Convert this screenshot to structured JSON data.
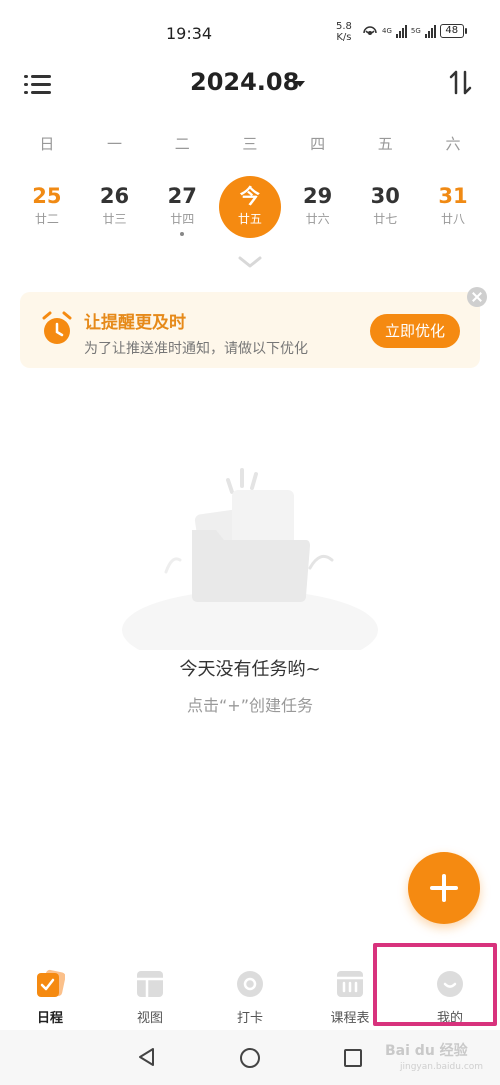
{
  "status_bar": {
    "time": "19:34",
    "speed_value": "5.8",
    "speed_unit": "K/s",
    "net_a": "4G",
    "net_b": "5G",
    "battery": "48"
  },
  "header": {
    "month": "2024.08"
  },
  "calendar": {
    "weekdays": [
      "日",
      "一",
      "二",
      "三",
      "四",
      "五",
      "六"
    ],
    "dates": [
      {
        "num": "25",
        "lunar": "廿二"
      },
      {
        "num": "26",
        "lunar": "廿三"
      },
      {
        "num": "27",
        "lunar": "廿四"
      },
      {
        "num": "今",
        "lunar": "廿五"
      },
      {
        "num": "29",
        "lunar": "廿六"
      },
      {
        "num": "30",
        "lunar": "廿七"
      },
      {
        "num": "31",
        "lunar": "廿八"
      }
    ]
  },
  "banner": {
    "title": "让提醒更及时",
    "desc": "为了让推送准时通知，请做以下优化",
    "button": "立即优化"
  },
  "empty": {
    "title": "今天没有任务哟~",
    "subtitle": "点击“+”创建任务"
  },
  "tabs": [
    {
      "label": "日程"
    },
    {
      "label": "视图"
    },
    {
      "label": "打卡"
    },
    {
      "label": "课程表"
    },
    {
      "label": "我的"
    }
  ],
  "watermark": {
    "brand": "Bai du 经验",
    "url": "jingyan.baidu.com"
  },
  "colors": {
    "accent": "#f58a11",
    "highlight": "#d8327d"
  }
}
